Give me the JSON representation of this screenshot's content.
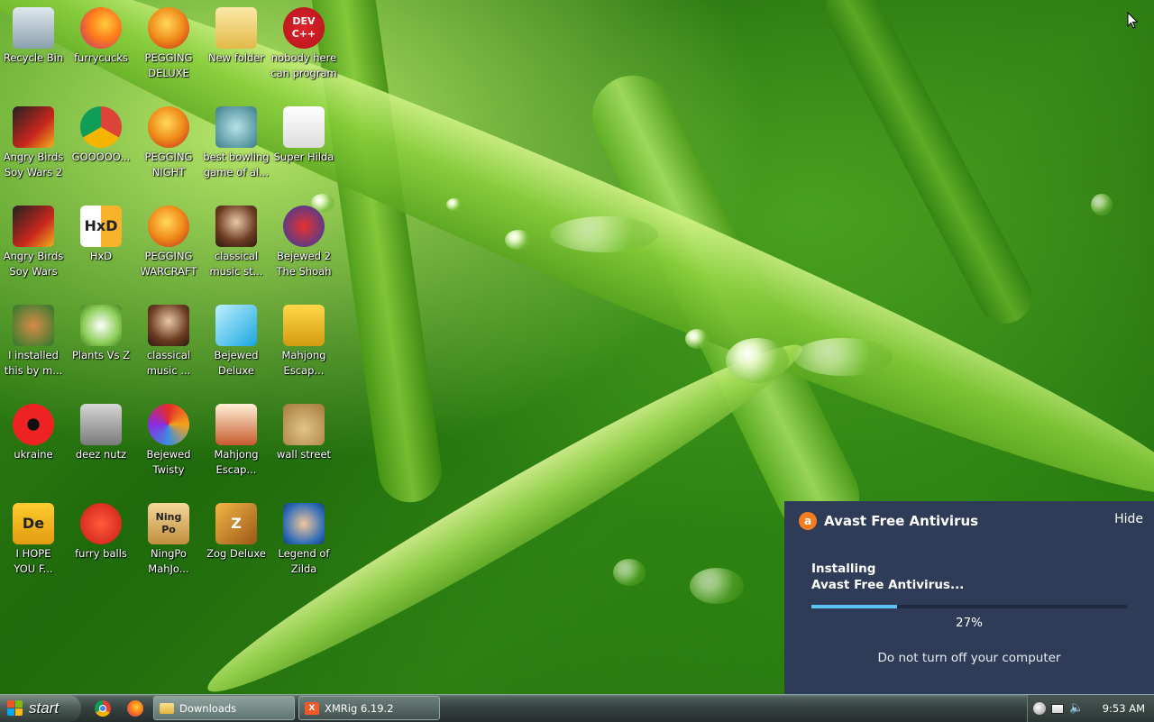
{
  "desktop": {
    "icons": [
      {
        "label": "Recycle Bin",
        "icon": "recycle-bin-icon"
      },
      {
        "label": "furrycucks",
        "icon": "firefox-icon"
      },
      {
        "label": "PEGGING\nDELUXE",
        "icon": "pegging-p-icon"
      },
      {
        "label": "New folder",
        "icon": "folder-icon"
      },
      {
        "label": "nobody here\ncan program",
        "icon": "devcpp-icon",
        "badge": "DEV\nC++"
      },
      {
        "label": "Angry Birds\nSoy Wars 2",
        "icon": "angry-birds-star-wars-icon"
      },
      {
        "label": "GOOOOO...",
        "icon": "chrome-icon"
      },
      {
        "label": "PEGGING\nNIGHT",
        "icon": "pegging-p-icon"
      },
      {
        "label": "best bowling\ngame of al...",
        "icon": "bowling-game-icon"
      },
      {
        "label": "Super Hilda",
        "icon": "pixel-cat-icon"
      },
      {
        "label": "Angry Birds\nSoy Wars",
        "icon": "angry-birds-star-wars-icon"
      },
      {
        "label": "HxD",
        "icon": "hxd-icon",
        "badge": "HxD"
      },
      {
        "label": "PEGGING\nWARCRAFT",
        "icon": "pegging-p-icon"
      },
      {
        "label": "classical\nmusic st...",
        "icon": "portrait-icon"
      },
      {
        "label": "Bejewed 2\nThe Shoah",
        "icon": "bejeweled-2-icon"
      },
      {
        "label": "I installed\nthis by m...",
        "icon": "character-icon"
      },
      {
        "label": "Plants Vs Z",
        "icon": "plants-vs-zombies-icon"
      },
      {
        "label": "classical\nmusic ...",
        "icon": "portrait-icon"
      },
      {
        "label": "Bejewed\nDeluxe",
        "icon": "diamond-gem-icon"
      },
      {
        "label": "Mahjong\nEscap...",
        "icon": "mahjong-tile-icon"
      },
      {
        "label": "ukraine",
        "icon": "radiation-icon"
      },
      {
        "label": "deez nutz",
        "icon": "stacked-windows-icon"
      },
      {
        "label": "Bejewed\nTwisty",
        "icon": "twist-gem-icon"
      },
      {
        "label": "Mahjong\nEscap...",
        "icon": "mahjong-gate-icon"
      },
      {
        "label": "wall street",
        "icon": "money-bag-icon"
      },
      {
        "label": "I HOPE\nYOU F...",
        "icon": "de-logo-icon",
        "badge": "De"
      },
      {
        "label": "furry balls",
        "icon": "red-fuzzball-icon"
      },
      {
        "label": "NingPo\nMahJo...",
        "icon": "ningpo-icon",
        "badge": "Ning\nPo"
      },
      {
        "label": "Zog Deluxe",
        "icon": "zog-icon",
        "badge": "Z"
      },
      {
        "label": "Legend of\nZilda",
        "icon": "zelda-character-icon"
      }
    ]
  },
  "popup": {
    "title": "Avast Free Antivirus",
    "hide_label": "Hide",
    "status_line1": "Installing",
    "status_line2": "Avast Free Antivirus...",
    "progress": 0.27,
    "progress_text": "27%",
    "warning": "Do not turn off your computer",
    "accent": "#f47c20",
    "bar_color": "#5cc3f2",
    "bg_color": "#2e3c58"
  },
  "taskbar": {
    "start_label": "start",
    "quicklaunch": [
      "chrome-icon",
      "firefox-icon"
    ],
    "tasks": [
      {
        "label": "Downloads",
        "icon": "folder-icon",
        "active": true
      },
      {
        "label": "XMRig 6.19.2",
        "icon": "xmrig-icon",
        "active": false
      }
    ],
    "clock": "9:53 AM"
  }
}
